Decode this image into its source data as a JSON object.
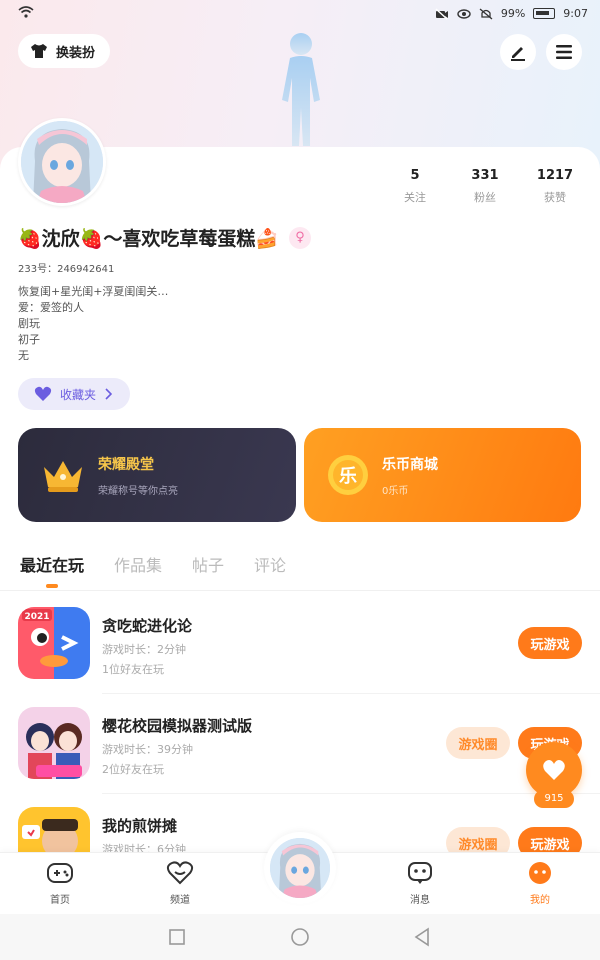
{
  "status_bar": {
    "battery": "99%",
    "time": "9:07"
  },
  "header": {
    "outfit_label": "换装扮"
  },
  "profile": {
    "stats": [
      {
        "value": "5",
        "label": "关注"
      },
      {
        "value": "331",
        "label": "粉丝"
      },
      {
        "value": "1217",
        "label": "获赞"
      }
    ],
    "nickname": "🍓沈欣🍓～喜欢吃草莓蛋糕🍰",
    "gender_symbol": "♀",
    "uid": "233号：246942641",
    "bio": "恢复闺+星光闺+浮夏闺闺关…\n爱：爱签的人\n剧玩\n初子\n无",
    "collection_label": "收藏夹"
  },
  "promos": [
    {
      "title": "荣耀殿堂",
      "subtitle": "荣耀称号等你点亮"
    },
    {
      "title": "乐币商城",
      "subtitle": "0乐币"
    }
  ],
  "tabs": [
    "最近在玩",
    "作品集",
    "帖子",
    "评论"
  ],
  "games": [
    {
      "name": "贪吃蛇进化论",
      "time": "游戏时长：2分钟",
      "friends": "1位好友在玩",
      "play_label": "玩游戏",
      "secondary_label": ""
    },
    {
      "name": "樱花校园模拟器测试版",
      "time": "游戏时长：39分钟",
      "friends": "2位好友在玩",
      "play_label": "玩游戏",
      "secondary_label": "游戏圈"
    },
    {
      "name": "我的煎饼摊",
      "time": "游戏时长：6分钟",
      "friends": "",
      "play_label": "玩游戏",
      "secondary_label": "游戏圈"
    }
  ],
  "like_count": "915",
  "nav": [
    {
      "label": "首页"
    },
    {
      "label": "频道"
    },
    {
      "label": "消息"
    },
    {
      "label": "我的"
    }
  ],
  "colors": {
    "accent": "#ff7a1a",
    "dark_card": "#2c2b3c"
  }
}
